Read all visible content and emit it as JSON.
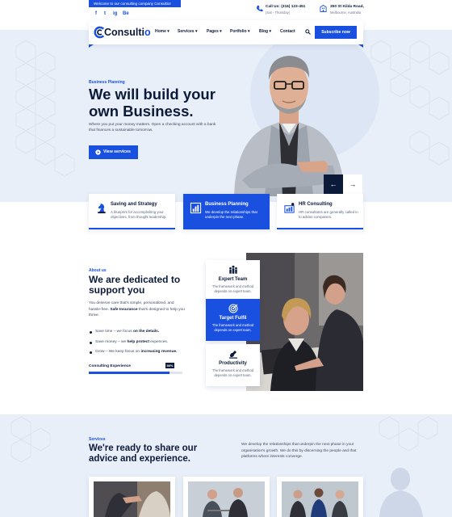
{
  "topbar": {
    "welcome": "Welcome to our consulting company Consultio!",
    "social": [
      "f",
      "t",
      "ig",
      "Be"
    ],
    "phone": {
      "title": "Call Us: (316) 123-451",
      "sub": "(Sat - Thursday)"
    },
    "address": {
      "title": "350 St Kilda Road,",
      "sub": "Melbourne, Australia"
    }
  },
  "nav": {
    "logo": "Consulti",
    "logo_accent": "o",
    "items": [
      "Home",
      "Services",
      "Pages",
      "Portfolio",
      "Blog",
      "Contact"
    ],
    "subscribe": "Subscribe now"
  },
  "hero": {
    "kicker": "Business Planning",
    "title": "We will build your own Business.",
    "desc": "Where you put your money matters. Open a checking account with a bank that finances a sustainable tomorrow.",
    "button": "View services",
    "prev": "←",
    "next": "→"
  },
  "features": [
    {
      "title": "Saving and Strategy",
      "text": "A blueprint for accomplishing your objectives, from thought leadership.",
      "icon": "chess-knight-icon"
    },
    {
      "title": "Business Planning",
      "text": "We develop the relationships that underpin the next phase.",
      "icon": "bar-chart-icon"
    },
    {
      "title": "HR Consulting",
      "text": "HR consultants are generally called in to advise companies.",
      "icon": "org-chart-icon"
    }
  ],
  "about": {
    "kicker": "About us",
    "title": "We are dedicated to support you",
    "desc_a": "You deserve care that's simple, personalized, and hassle-free. ",
    "desc_b": "Safe Insurance",
    "desc_c": " that's designed to help you thrive.",
    "list": [
      {
        "a": "Save time – we focus ",
        "b": "on the details."
      },
      {
        "a": "Save money – we ",
        "b": "help protect",
        "c": " expences."
      },
      {
        "a": "Grow – We keep focus on ",
        "b": "increasing revenue."
      }
    ],
    "bar_label": "Consulting Experience",
    "bar_value": 86,
    "bar_badge": "86%",
    "cards": [
      {
        "title": "Expert Team",
        "text": "The framework and method depends on expert team.",
        "icon": "team-icon"
      },
      {
        "title": "Target Fulfil",
        "text": "The framework and method depends on expert team.",
        "icon": "target-icon"
      },
      {
        "title": "Productivity",
        "text": "The framework and method depends on expert team.",
        "icon": "productivity-icon"
      }
    ]
  },
  "services": {
    "kicker": "Services",
    "title": "We're ready to share our advice and experience.",
    "desc": "We develop the relationships that underpin the next phase in your organisation's growth. We do this by discerning the people and that platforms where interests converge."
  },
  "colors": {
    "accent": "#1a50e0",
    "navy": "#0c1a3a",
    "bg": "#e9eff8"
  }
}
